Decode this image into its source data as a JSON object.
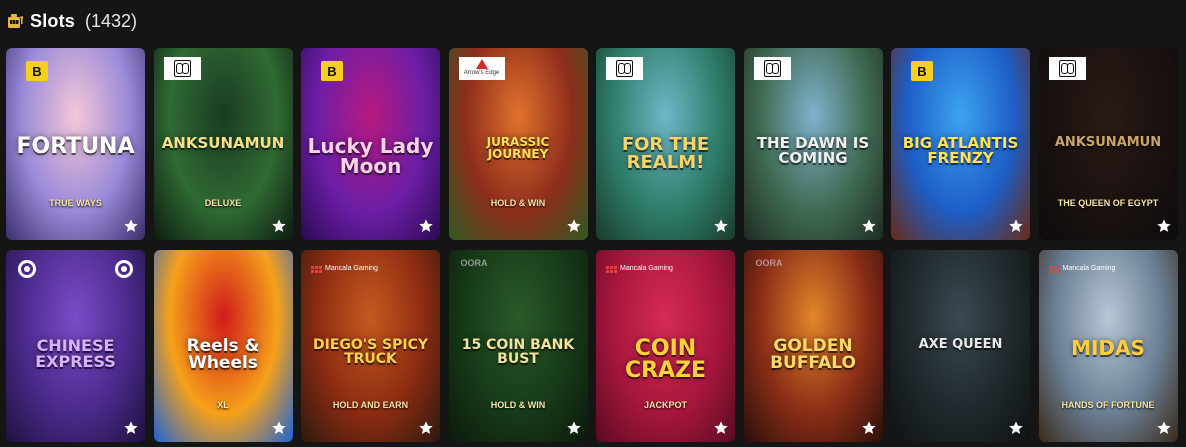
{
  "section": {
    "title": "Slots",
    "count": "(1432)",
    "icon": "slot-machine-icon",
    "accent": "#e8b73a"
  },
  "games": [
    {
      "title": "FORTUNA",
      "subtitle": "TRUE WAYS",
      "provider_mark": "B",
      "badge": "b",
      "colors": [
        "#f3c7d8",
        "#9a8ad8",
        "#3a2d6b"
      ],
      "title_color": "#ffffff",
      "title_size": 22
    },
    {
      "title": "ANKSUNAMUN",
      "subtitle": "DELUXE",
      "provider_mark": "",
      "badge": "provider",
      "colors": [
        "#1b3b22",
        "#2f6a33",
        "#0d1b10"
      ],
      "title_color": "#f4e08a",
      "title_size": 15
    },
    {
      "title": "Lucky Lady Moon",
      "subtitle": "",
      "provider_mark": "B",
      "badge": "b",
      "colors": [
        "#b8197e",
        "#6c1ea6",
        "#2a0a52"
      ],
      "title_color": "#ffd1ea",
      "title_size": 20
    },
    {
      "title": "JURASSIC JOURNEY",
      "subtitle": "HOLD & WIN",
      "provider_mark": "Arrow's Edge",
      "badge": "arrow",
      "colors": [
        "#e1722d",
        "#8d2d1c",
        "#2d5a20"
      ],
      "title_color": "#ffe15a",
      "title_size": 12
    },
    {
      "title": "FOR THE REALM!",
      "subtitle": "",
      "provider_mark": "",
      "badge": "provider",
      "colors": [
        "#6fb6c6",
        "#2e7d6a",
        "#1a3b2a"
      ],
      "title_color": "#f5d56a",
      "title_size": 18
    },
    {
      "title": "THE DAWN IS COMING",
      "subtitle": "",
      "provider_mark": "",
      "badge": "provider",
      "colors": [
        "#7fb1cc",
        "#3f6a52",
        "#1f2b22"
      ],
      "title_color": "#f0f0f0",
      "title_size": 15
    },
    {
      "title": "BIG ATLANTIS FRENZY",
      "subtitle": "",
      "provider_mark": "B",
      "badge": "b",
      "colors": [
        "#3da3f0",
        "#1d5ec7",
        "#6a2a14"
      ],
      "title_color": "#ffe25a",
      "title_size": 15
    },
    {
      "title": "ANKSUNAMUN",
      "subtitle": "THE QUEEN OF EGYPT",
      "provider_mark": "",
      "badge": "provider",
      "colors": [
        "#2a1a14",
        "#1a1210",
        "#0d0b0a"
      ],
      "title_color": "#c9a56a",
      "title_size": 13
    },
    {
      "title": "CHINESE EXPRESS",
      "subtitle": "",
      "provider_mark": "",
      "badge": "ring",
      "colors": [
        "#7a4cc9",
        "#4a2a8a",
        "#1f1240"
      ],
      "title_color": "#d9b0ff",
      "title_size": 16
    },
    {
      "title": "Reels & Wheels",
      "subtitle": "XL",
      "provider_mark": "",
      "badge": "none",
      "colors": [
        "#d11b1b",
        "#f5a11a",
        "#1d63d8"
      ],
      "title_color": "#ffffff",
      "title_size": 17
    },
    {
      "title": "DIEGO'S SPICY TRUCK",
      "subtitle": "HOLD AND EARN",
      "provider_mark": "Mancala Gaming",
      "badge": "mancala",
      "colors": [
        "#c55a1f",
        "#8c2b12",
        "#2d1a0e"
      ],
      "title_color": "#ffd24a",
      "title_size": 14
    },
    {
      "title": "15 COIN BANK BUST",
      "subtitle": "HOLD & WIN",
      "provider_mark": "OORA",
      "badge": "tag",
      "colors": [
        "#2c5a2a",
        "#173a18",
        "#0b1a0b"
      ],
      "title_color": "#f1e3a0",
      "title_size": 14
    },
    {
      "title": "COIN CRAZE",
      "subtitle": "JACKPOT",
      "provider_mark": "Mancala Gaming",
      "badge": "mancala",
      "colors": [
        "#d62a55",
        "#a6163c",
        "#5a0b22"
      ],
      "title_color": "#ffd23a",
      "title_size": 22
    },
    {
      "title": "GOLDEN BUFFALO",
      "subtitle": "",
      "provider_mark": "OORA",
      "badge": "tag",
      "colors": [
        "#e3862a",
        "#8a2d17",
        "#2a0f09"
      ],
      "title_color": "#ffd96a",
      "title_size": 17
    },
    {
      "title": "AXE QUEEN",
      "subtitle": "",
      "provider_mark": "",
      "badge": "none",
      "colors": [
        "#3a4a52",
        "#1f282c",
        "#0e1214"
      ],
      "title_color": "#e8e8e8",
      "title_size": 13
    },
    {
      "title": "MIDAS",
      "subtitle": "HANDS OF FORTUNE",
      "provider_mark": "Mancala Gaming",
      "badge": "mancala",
      "colors": [
        "#b7c8d6",
        "#6a7f94",
        "#3a2a1a"
      ],
      "title_color": "#ffce3a",
      "title_size": 20
    }
  ]
}
